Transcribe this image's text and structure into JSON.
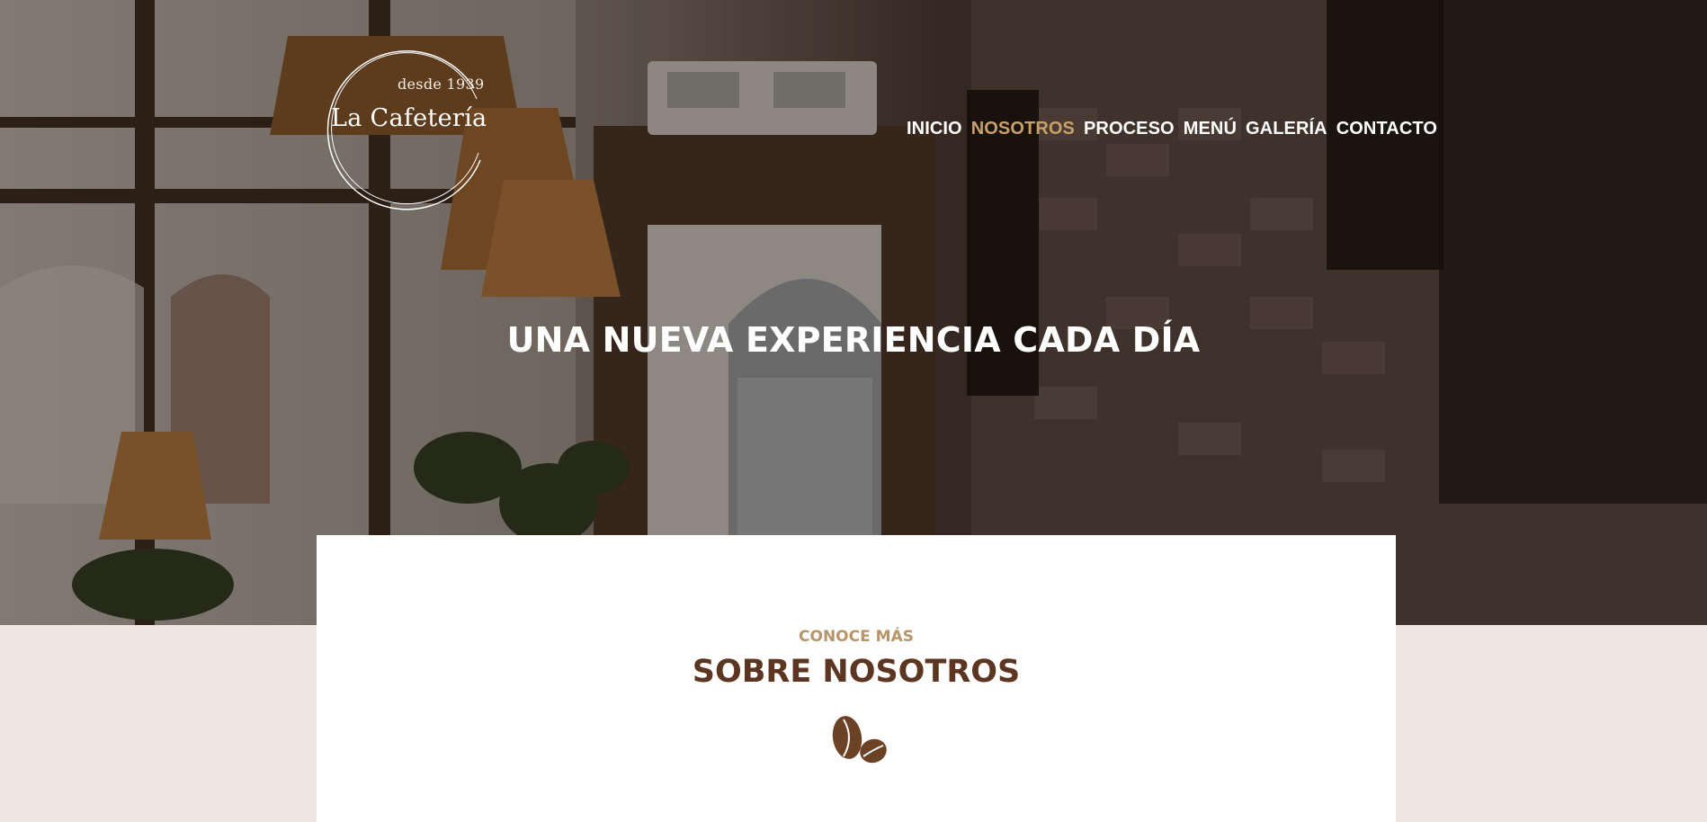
{
  "logo": {
    "since": "desde 1939",
    "name": "La Cafetería"
  },
  "nav": {
    "items": [
      {
        "label": "INICIO",
        "active": false
      },
      {
        "label": "NOSOTROS",
        "active": true
      },
      {
        "label": "PROCESO",
        "active": false
      },
      {
        "label": "MENÚ",
        "active": false
      },
      {
        "label": "GALERÍA",
        "active": false
      },
      {
        "label": "CONTACTO",
        "active": false
      }
    ]
  },
  "hero": {
    "title": "UNA NUEVA EXPERIENCIA CADA DÍA"
  },
  "about": {
    "kicker": "CONOCE MÁS",
    "title": "SOBRE NOSOTROS",
    "icon": "coffee-beans-icon"
  },
  "colors": {
    "accent": "#c9a06b",
    "heading": "#5c3620",
    "page_bg": "#ece7e0",
    "nav_text": "#ffffff"
  }
}
